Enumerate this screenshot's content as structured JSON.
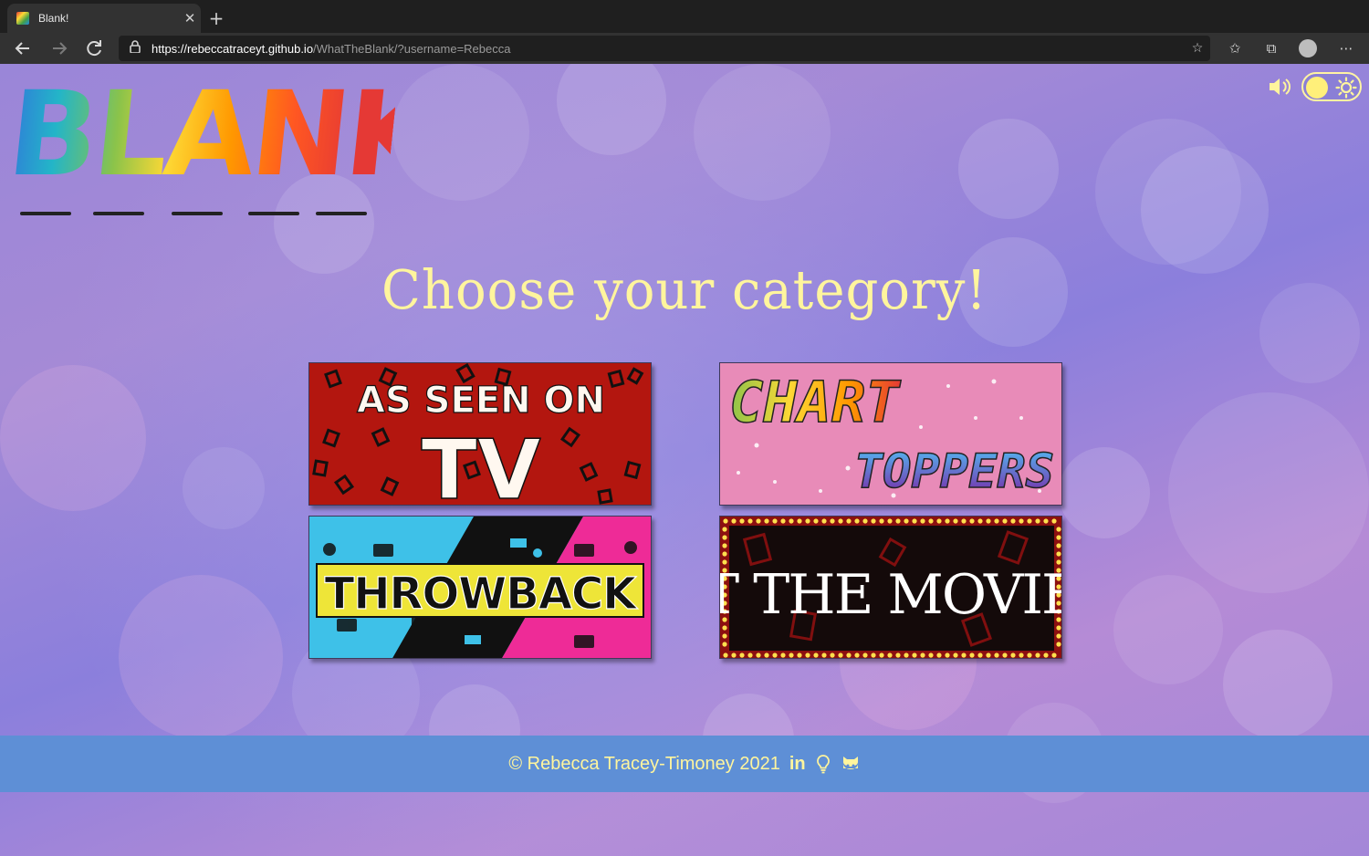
{
  "browser": {
    "tab_title": "Blank!",
    "tab_close": "✕",
    "new_tab": "+",
    "url_host": "https://rebeccatraceyt.github.io",
    "url_path": "/WhatTheBlank/?username=Rebecca"
  },
  "app": {
    "logo_text": "BLANK!",
    "heading": "Choose your category!",
    "categories": [
      {
        "id": "tv",
        "label_top": "AS SEEN ON",
        "label_main": "TV"
      },
      {
        "id": "chart",
        "label_top": "CHART",
        "label_main": "TOPPERS"
      },
      {
        "id": "throwback",
        "label_main": "THROWBACK"
      },
      {
        "id": "movies",
        "label_main": "AT THE MOVIES"
      }
    ]
  },
  "footer": {
    "copyright": "© Rebecca Tracey-Timoney 2021",
    "linkedin": "in"
  },
  "colors": {
    "accent_yellow": "#fff59d",
    "footer_blue": "#5e8fd6",
    "tv_red": "#b3160f",
    "chart_pink": "#e88bb8",
    "throwback_cyan": "#3ec1e8",
    "throwback_pink": "#ee2b97",
    "movies_dark": "#140a0a"
  },
  "icons": {
    "back": "arrow-left-icon",
    "forward": "arrow-right-icon",
    "reload": "reload-icon",
    "lock": "lock-icon",
    "sound": "speaker-icon",
    "theme": "sun-icon",
    "idea": "lightbulb-icon",
    "github": "github-icon"
  }
}
